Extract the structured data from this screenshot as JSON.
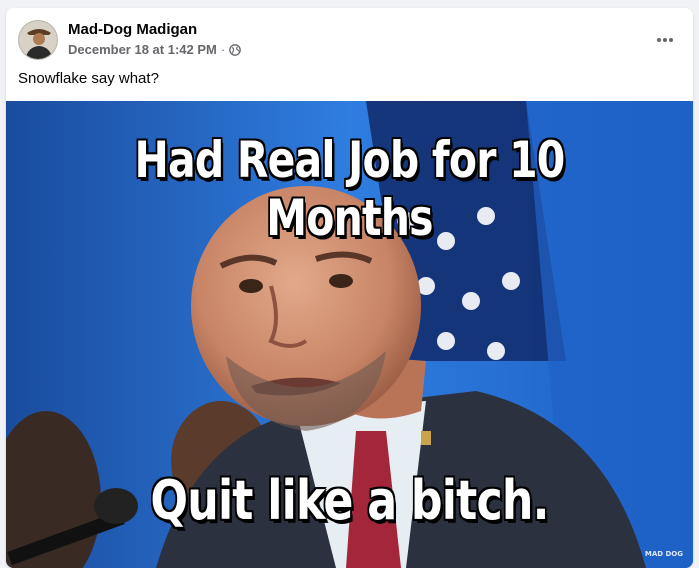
{
  "post": {
    "author": "Mad-Dog Madigan",
    "timestamp": "December 18 at 1:42 PM",
    "separator": "·",
    "privacy_icon": "globe-icon",
    "more_icon": "more-options-icon",
    "caption": "Snowflake say what?",
    "media": {
      "top_text": "Had Real Job for 10 Months",
      "bottom_text": "Quit like a bitch.",
      "watermark": "MAD DOG"
    }
  },
  "colors": {
    "primary_text": "#050505",
    "secondary_text": "#65676b",
    "card_bg": "#ffffff",
    "page_bg": "#f0f2f5"
  }
}
